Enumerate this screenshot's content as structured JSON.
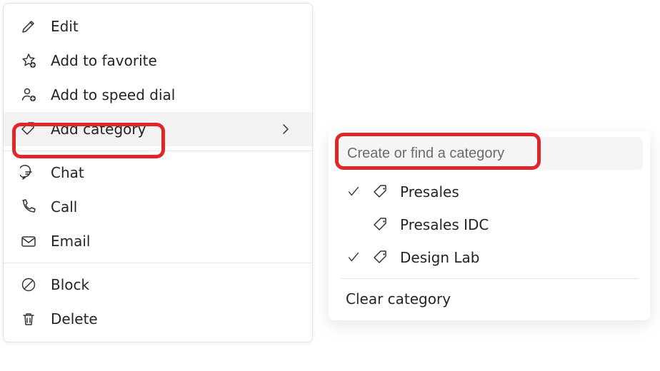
{
  "menu": {
    "items": [
      {
        "label": "Edit"
      },
      {
        "label": "Add to favorite"
      },
      {
        "label": "Add to speed dial"
      },
      {
        "label": "Add category"
      },
      {
        "label": "Chat"
      },
      {
        "label": "Call"
      },
      {
        "label": "Email"
      },
      {
        "label": "Block"
      },
      {
        "label": "Delete"
      }
    ]
  },
  "submenu": {
    "search_placeholder": "Create or find a category",
    "categories": [
      {
        "label": "Presales",
        "checked": true
      },
      {
        "label": "Presales IDC",
        "checked": false
      },
      {
        "label": "Design Lab",
        "checked": true
      }
    ],
    "clear_label": "Clear category"
  }
}
